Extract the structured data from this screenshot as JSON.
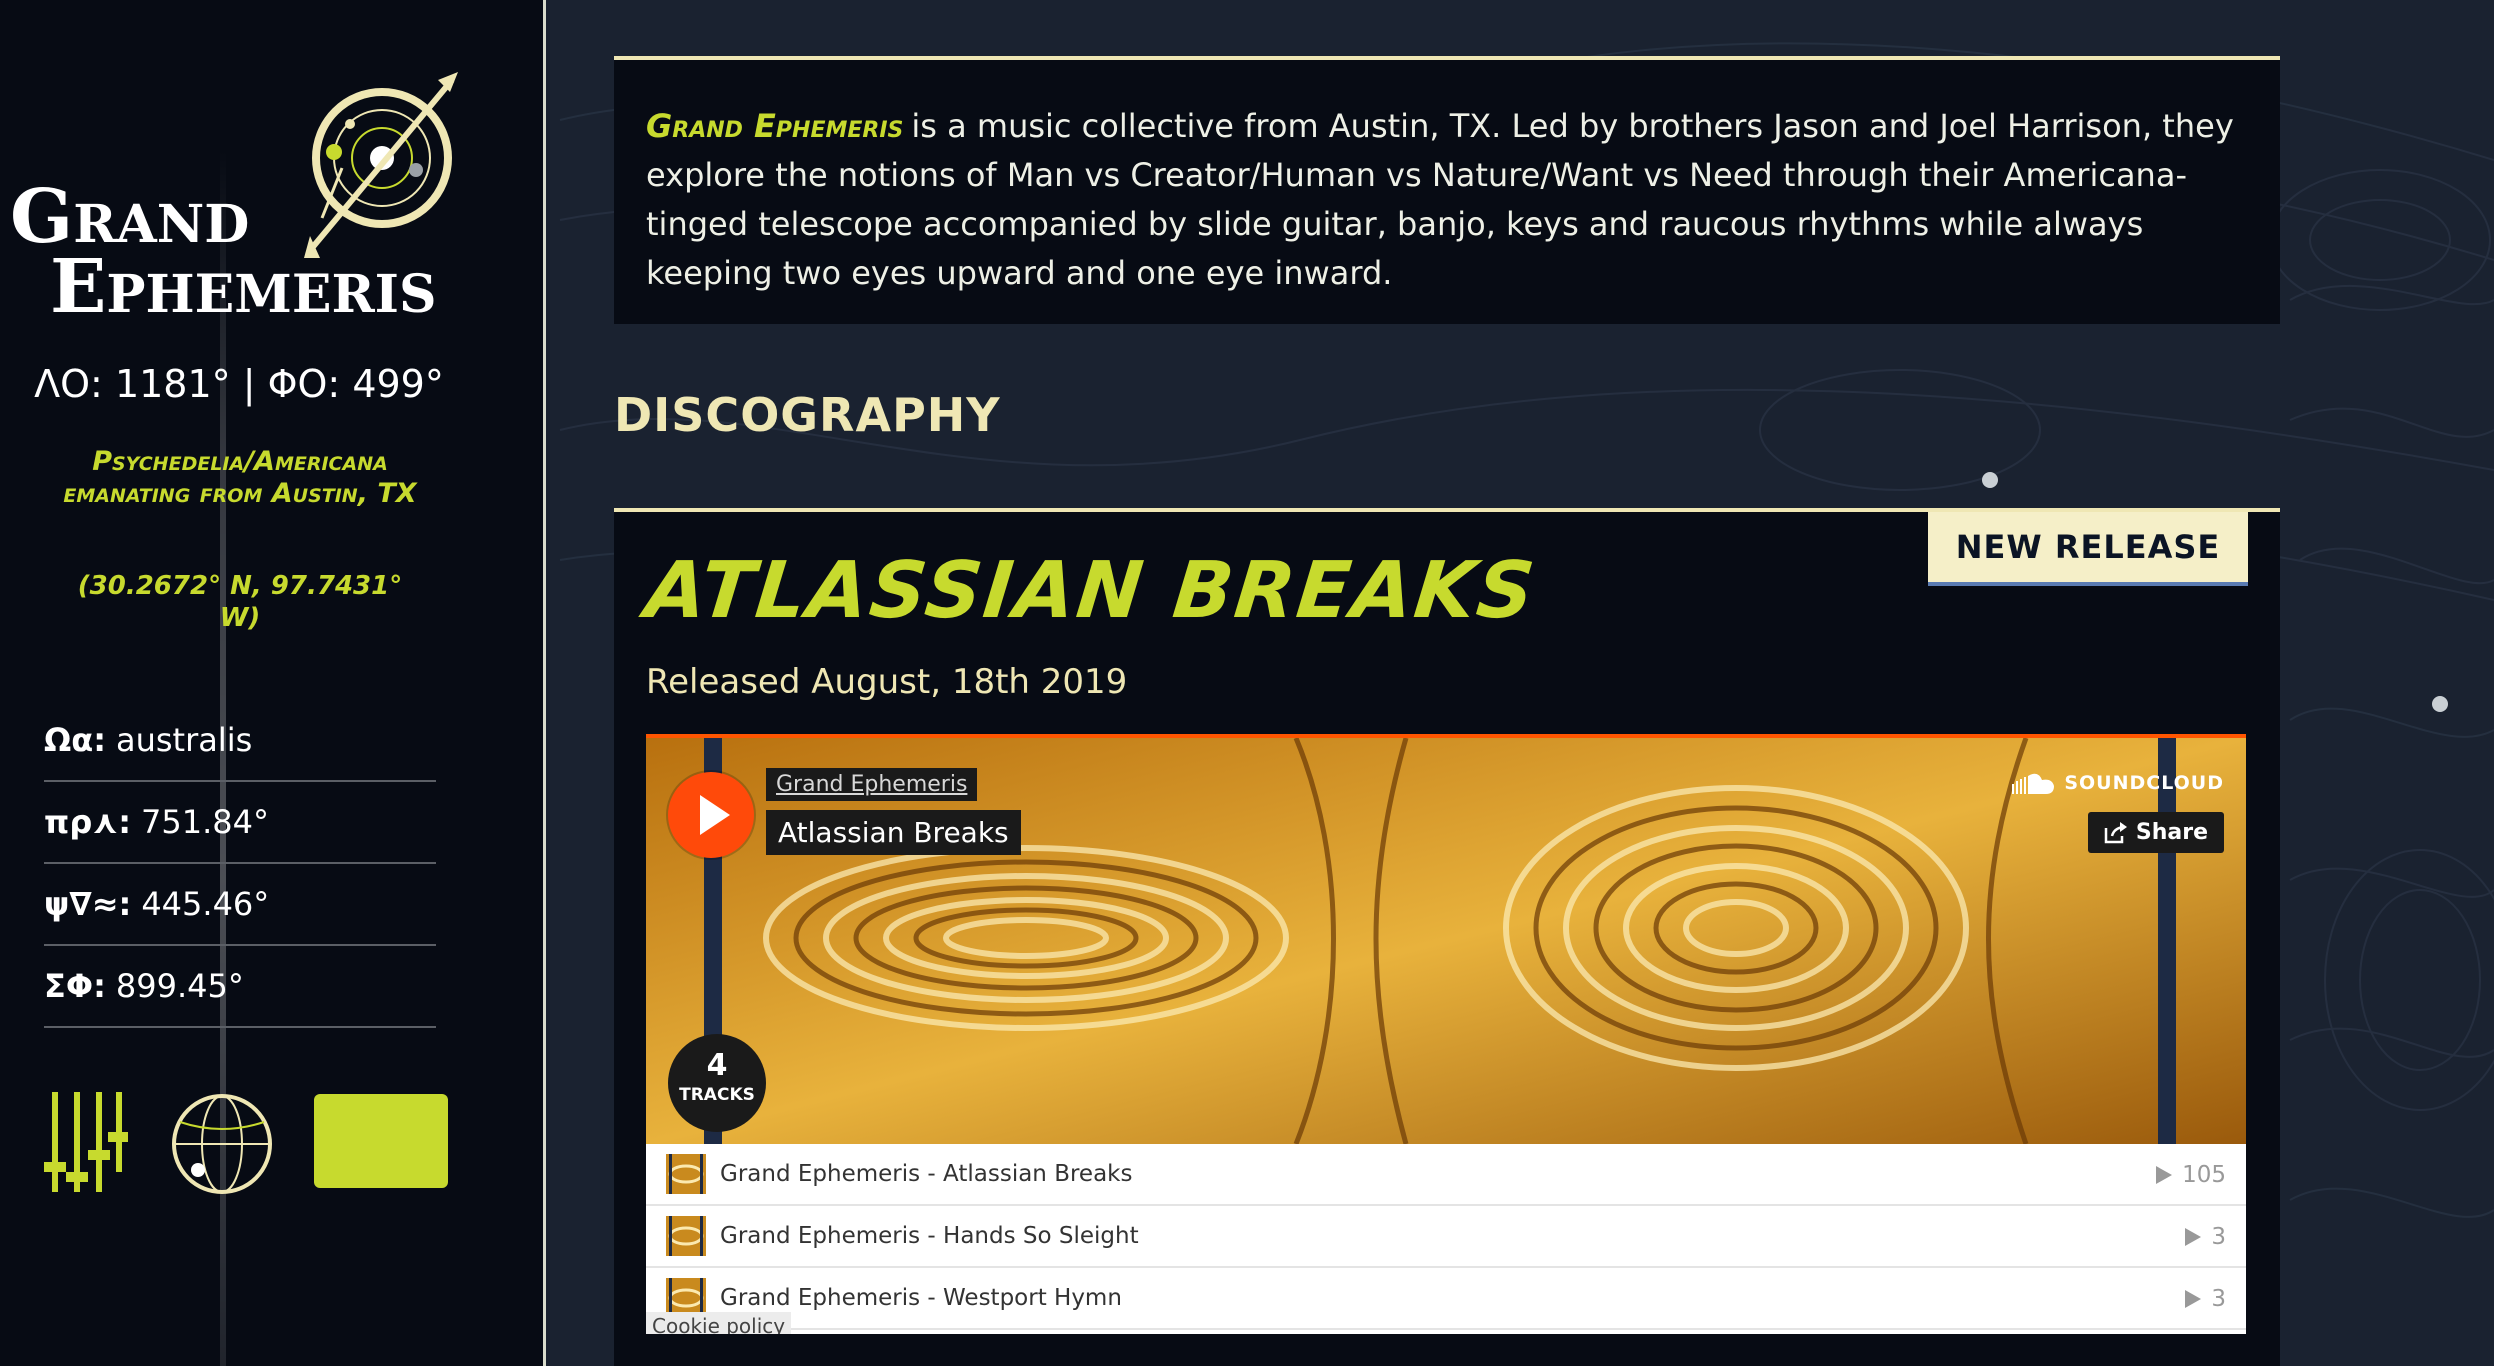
{
  "sidebar": {
    "logo": {
      "line1": "Grand",
      "line2": "Ephemeris"
    },
    "coords_readout": "ΛΟ: 1181° | ΦΟ: 499°",
    "genre_tag": "Psychedelia/Americana emanating from Austin, TX",
    "geo_tag": "(30.2672° N, 97.7431° W)",
    "stats": [
      {
        "key": "Ωα:",
        "value": "australis"
      },
      {
        "key": "πρ⋏:",
        "value": "751.84°"
      },
      {
        "key": "ψ∇≈:",
        "value": "445.46°"
      },
      {
        "key": "ΣΦ:",
        "value": "899.45°"
      }
    ],
    "controls": {
      "mixer_icon": "mixer-sliders-icon",
      "globe_icon": "globe-icon",
      "swatch_color": "#c7da2e"
    }
  },
  "intro": {
    "band_name": "Grand Ephemeris",
    "text": "is a music collective from Austin, TX. Led by brothers Jason and Joel Harrison, they explore the notions of Man vs Creator/Human vs Nature/Want vs Need through their Americana-tinged telescope accompanied by slide guitar, banjo, keys and raucous rhythms while always keeping two eyes upward and one eye inward."
  },
  "discography": {
    "heading": "DISCOGRAPHY",
    "badge": "NEW RELEASE",
    "release_title": "ATLASSIAN BREAKS",
    "release_date": "Released August, 18th 2019"
  },
  "player": {
    "artist": "Grand Ephemeris",
    "title": "Atlassian Breaks",
    "brand": "SOUNDCLOUD",
    "share_label": "Share",
    "track_count": "4",
    "track_count_label": "TRACKS",
    "tracks": [
      {
        "title": "Grand Ephemeris - Atlassian Breaks",
        "plays": "105"
      },
      {
        "title": "Grand Ephemeris - Hands So Sleight",
        "plays": "3"
      },
      {
        "title": "Grand Ephemeris - Westport Hymn",
        "plays": "3"
      }
    ],
    "cookie_label": "Cookie policy"
  },
  "colors": {
    "accent_lime": "#c7da2e",
    "cream": "#efe7b4",
    "panel_bg": "#070b14",
    "page_bg": "#1a2230",
    "soundcloud_orange": "#ff5500"
  }
}
